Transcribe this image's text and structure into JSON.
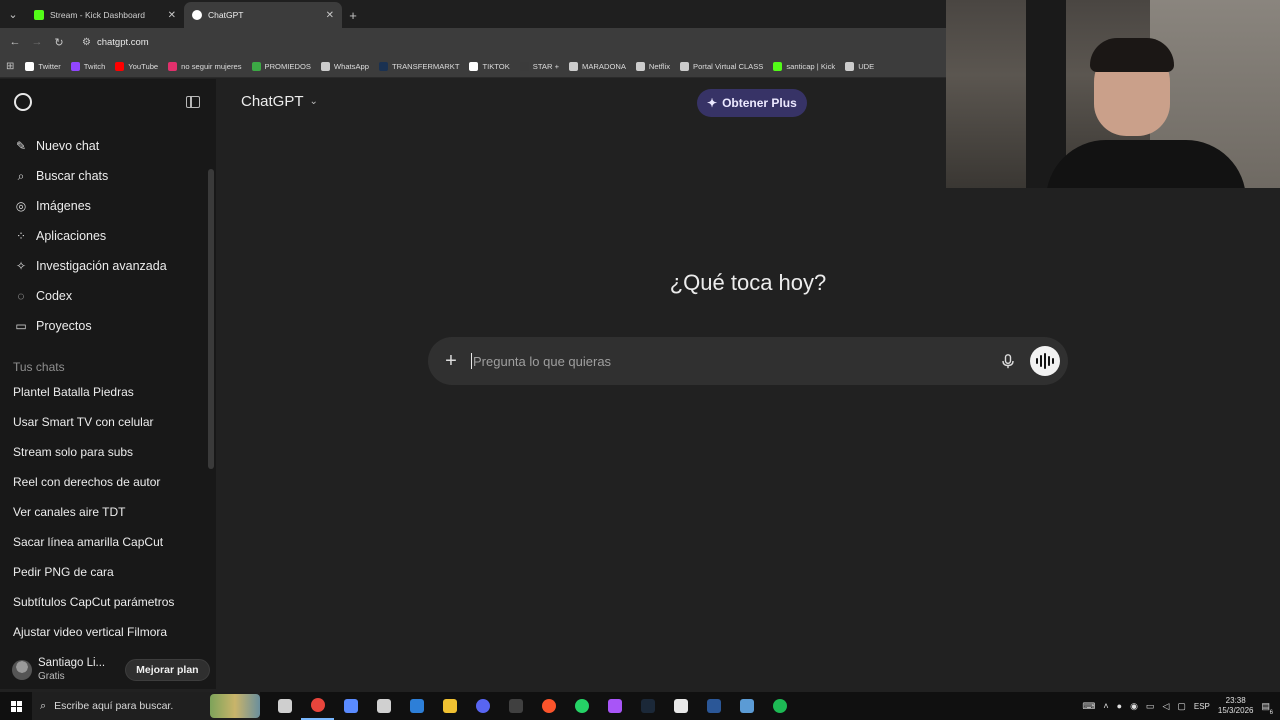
{
  "browser": {
    "tabs": [
      {
        "title": "Stream - Kick Dashboard",
        "favicon_color": "#53fc18",
        "active": false
      },
      {
        "title": "ChatGPT",
        "favicon_color": "#ffffff",
        "active": true
      }
    ],
    "url": "chatgpt.com",
    "bookmarks": [
      {
        "label": "Twitter",
        "color": "#ffffff"
      },
      {
        "label": "Twitch",
        "color": "#9146ff"
      },
      {
        "label": "YouTube",
        "color": "#ff0000"
      },
      {
        "label": "no seguir mujeres",
        "color": "#e1306c"
      },
      {
        "label": "PROMIEDOS",
        "color": "#3ca945"
      },
      {
        "label": "WhatsApp",
        "color": "#cccccc"
      },
      {
        "label": "TRANSFERMARKT",
        "color": "#1a3151"
      },
      {
        "label": "TIKTOK",
        "color": "#ffffff"
      },
      {
        "label": "STAR +",
        "color": "#3b3b3b"
      },
      {
        "label": "MARADONA",
        "color": "#cccccc"
      },
      {
        "label": "Netflix",
        "color": "#cccccc"
      },
      {
        "label": "Portal Virtual CLASS",
        "color": "#cccccc"
      },
      {
        "label": "santicap | Kick",
        "color": "#53fc18"
      },
      {
        "label": "UDE",
        "color": "#cccccc"
      }
    ]
  },
  "sidebar": {
    "menu": [
      {
        "label": "Nuevo chat",
        "icon": "edit-icon",
        "glyph": "✎"
      },
      {
        "label": "Buscar chats",
        "icon": "search-icon",
        "glyph": "⌕"
      },
      {
        "label": "Imágenes",
        "icon": "images-icon",
        "glyph": "◎"
      },
      {
        "label": "Aplicaciones",
        "icon": "apps-icon",
        "glyph": "⁘"
      },
      {
        "label": "Investigación avanzada",
        "icon": "research-icon",
        "glyph": "✧"
      },
      {
        "label": "Codex",
        "icon": "codex-icon",
        "glyph": "◌"
      },
      {
        "label": "Proyectos",
        "icon": "folder-icon",
        "glyph": "▭"
      }
    ],
    "section_title": "Tus chats",
    "chats": [
      "Plantel Batalla Piedras",
      "Usar Smart TV con celular",
      "Stream solo para subs",
      "Reel con derechos de autor",
      "Ver canales aire TDT",
      "Sacar línea amarilla CapCut",
      "Pedir PNG de cara",
      "Subtítulos CapCut parámetros",
      "Ajustar video vertical Filmora"
    ],
    "user": {
      "name": "Santiago Li...",
      "plan": "Gratis",
      "upgrade_label": "Mejorar plan"
    }
  },
  "main": {
    "model": "ChatGPT",
    "plus_button": "Obtener Plus",
    "headline": "¿Qué toca hoy?",
    "composer_placeholder": "Pregunta lo que quieras"
  },
  "taskbar": {
    "search_placeholder": "Escribe aquí para buscar.",
    "apps": [
      {
        "name": "task-view-icon",
        "color": "#cfcfcf"
      },
      {
        "name": "chrome-icon",
        "color": "#e8453c"
      },
      {
        "name": "copilot-icon",
        "color": "#5a8bff"
      },
      {
        "name": "epic-games-icon",
        "color": "#d0d0d0"
      },
      {
        "name": "edge-icon",
        "color": "#2d7fd8"
      },
      {
        "name": "file-explorer-icon",
        "color": "#f1c232"
      },
      {
        "name": "discord-icon",
        "color": "#5865f2"
      },
      {
        "name": "obs-icon",
        "color": "#404040"
      },
      {
        "name": "brave-icon",
        "color": "#fb542b"
      },
      {
        "name": "whatsapp-icon",
        "color": "#25d366"
      },
      {
        "name": "obsidian-icon",
        "color": "#a855f7"
      },
      {
        "name": "steam-icon",
        "color": "#1b2838"
      },
      {
        "name": "capcut-icon",
        "color": "#e8e8e8"
      },
      {
        "name": "terminal-icon",
        "color": "#2b5797"
      },
      {
        "name": "shield-icon",
        "color": "#5b9bd5"
      },
      {
        "name": "spotify-icon",
        "color": "#1db954"
      }
    ],
    "language": "ESP",
    "time": "23:38",
    "date": "15/3/2026",
    "notification_count": "6"
  }
}
